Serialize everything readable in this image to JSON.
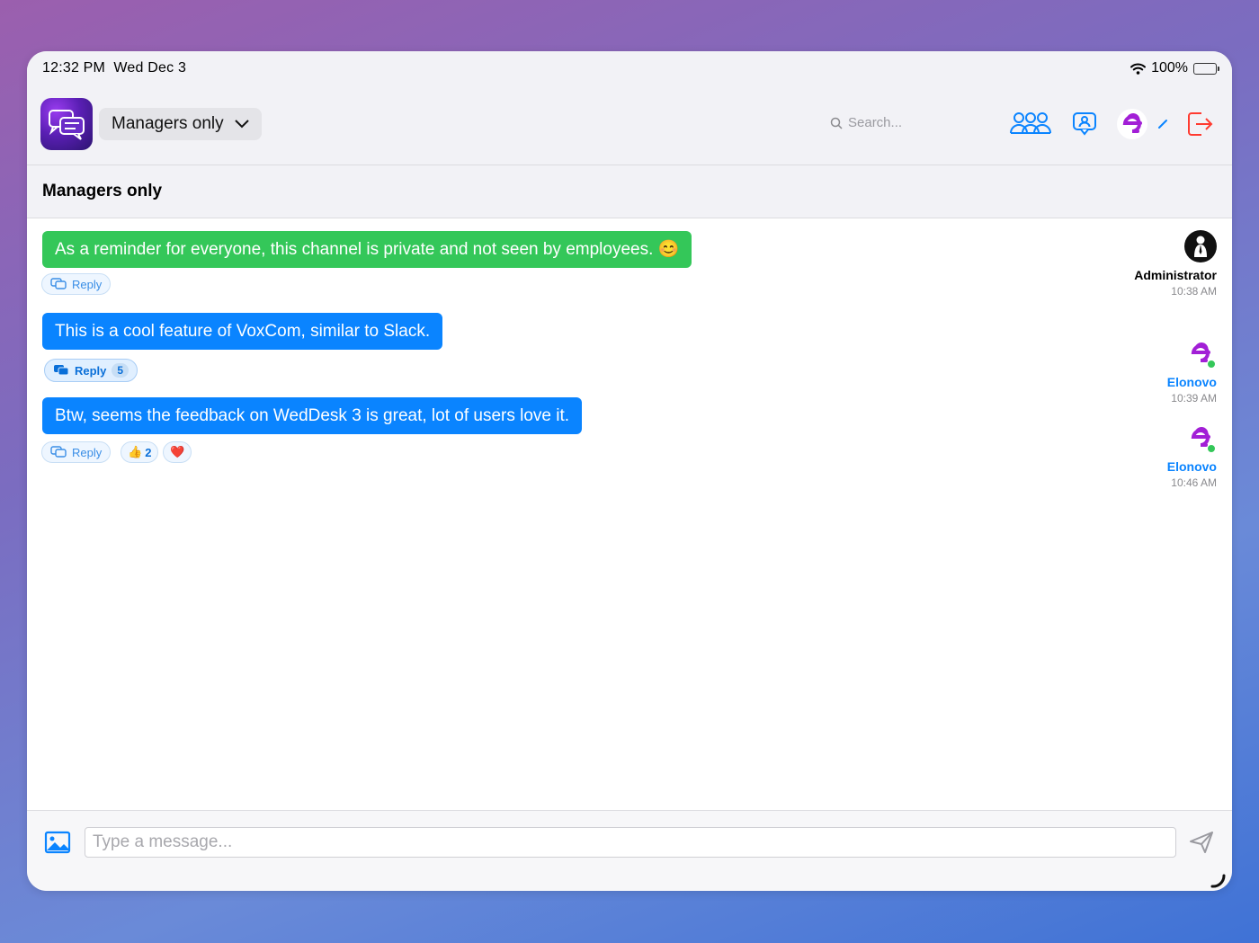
{
  "status": {
    "time": "12:32 PM",
    "date": "Wed Dec 3",
    "battery": "100%"
  },
  "toolbar": {
    "channel": "Managers only",
    "search_placeholder": "Search..."
  },
  "header": {
    "title": "Managers only"
  },
  "messages": [
    {
      "text": "As a reminder for everyone, this channel is private and not seen by employees. 😊",
      "author": "Administrator",
      "time": "10:38 AM",
      "reply_label": "Reply",
      "color": "#34c759"
    },
    {
      "text": "This is a cool feature of VoxCom, similar to Slack.",
      "author": "Elonovo",
      "time": "10:39 AM",
      "reply_label": "Reply",
      "reply_count": "5",
      "color": "#0a84ff"
    },
    {
      "text": "Btw, seems the feedback on WedDesk 3 is great, lot of users love it.",
      "author": "Elonovo",
      "time": "10:46 AM",
      "reply_label": "Reply",
      "reactions": [
        {
          "emoji": "👍",
          "count": "2"
        },
        {
          "emoji": "❤️"
        }
      ],
      "color": "#0a84ff"
    }
  ],
  "composer": {
    "placeholder": "Type a message..."
  },
  "colors": {
    "accent": "#0a84ff",
    "brand": "#a21fd6",
    "logout": "#ff3b30",
    "online": "#34c759"
  }
}
